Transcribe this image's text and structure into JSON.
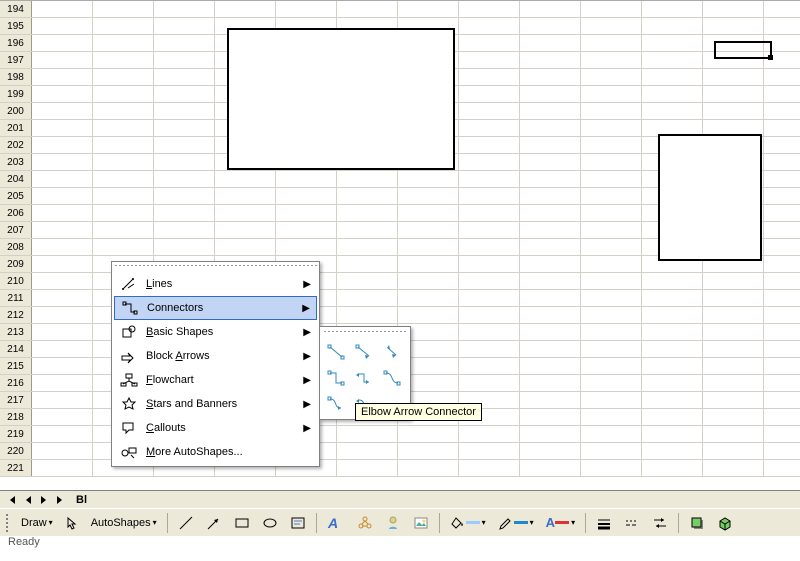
{
  "rows": [
    194,
    195,
    196,
    197,
    198,
    199,
    200,
    201,
    202,
    203,
    204,
    205,
    206,
    207,
    208,
    209,
    210,
    211,
    212,
    213,
    214,
    215,
    216,
    217,
    218,
    219,
    220,
    221
  ],
  "sheet_tab": "Bl",
  "status": "Ready",
  "toolbar": {
    "draw_label": "Draw",
    "autoshapes_label": "AutoShapes"
  },
  "menu": {
    "items": [
      {
        "label": "Lines",
        "hot": "L",
        "sub": true
      },
      {
        "label": "Connectors",
        "hot": "N",
        "sub": true,
        "hl": true
      },
      {
        "label": "Basic Shapes",
        "hot": "B",
        "sub": true
      },
      {
        "label": "Block Arrows",
        "hot": "A",
        "sub": true
      },
      {
        "label": "Flowchart",
        "hot": "F",
        "sub": true
      },
      {
        "label": "Stars and Banners",
        "hot": "S",
        "sub": true
      },
      {
        "label": "Callouts",
        "hot": "C",
        "sub": true
      },
      {
        "label": "More AutoShapes...",
        "hot": "M",
        "sub": false
      }
    ]
  },
  "submenu": {
    "tooltip": "Elbow Arrow Connector",
    "selected_index": 4,
    "items": [
      "straight-connector",
      "straight-arrow-connector",
      "straight-double-arrow-connector",
      "elbow-connector",
      "elbow-arrow-connector",
      "elbow-double-arrow-connector",
      "curved-connector",
      "curved-arrow-connector",
      "curved-double-arrow-connector"
    ]
  }
}
